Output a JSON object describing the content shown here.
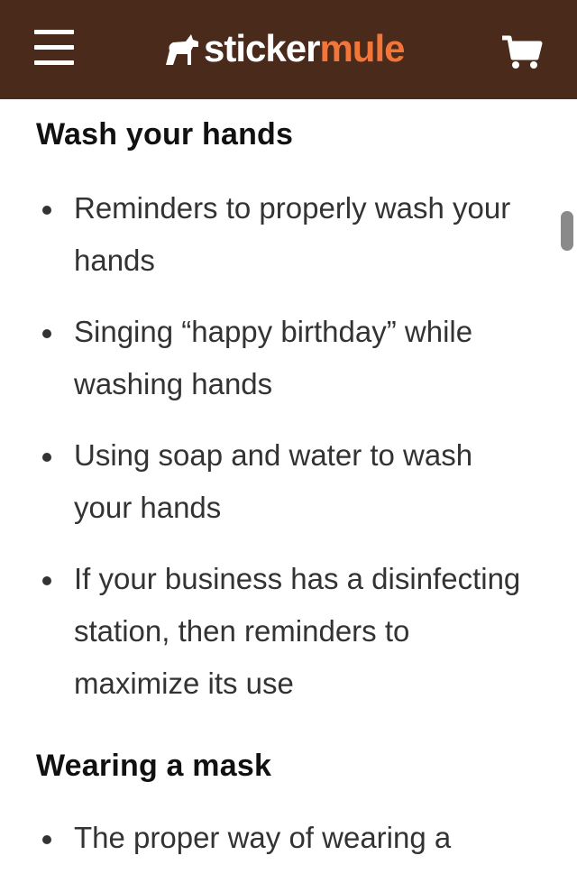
{
  "header": {
    "menu_icon": "hamburger-menu-icon",
    "logo_word1": "sticker",
    "logo_word2": "mule",
    "cart_icon": "shopping-cart-icon",
    "colors": {
      "bar": "#4a2a1a",
      "accent": "#f2763a"
    }
  },
  "sections": [
    {
      "heading": "Wash your hands",
      "items": [
        "Reminders to properly wash your hands",
        "Singing “happy birthday” while washing hands",
        "Using soap and water to wash your hands",
        "If your business has a disinfecting station, then reminders to maximize its use"
      ]
    },
    {
      "heading": "Wearing a mask",
      "items": [
        "The proper way of wearing a"
      ]
    }
  ]
}
